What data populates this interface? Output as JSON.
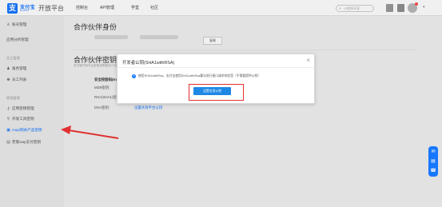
{
  "header": {
    "logo_glyph": "支",
    "brand_name": "支付宝",
    "brand_sub": "ALIPAY",
    "portal_title": "开放平台",
    "nav": [
      "控制台",
      "API管理",
      "学堂",
      "社区"
    ],
    "search_placeholder": "小程序开发",
    "icons": [
      "search-icon",
      "message-icon",
      "notification-icon",
      "avatar",
      "chevron-down-icon"
    ]
  },
  "sidebar": {
    "items": [
      {
        "label": "账号管理",
        "icon": "user-icon",
        "section": null
      },
      {
        "label": "应用分析管理",
        "icon": null,
        "section": null
      }
    ],
    "sections": [
      "员工管理",
      "密钥管理"
    ],
    "staff_items": [
      {
        "label": "角色管理",
        "icon": "role-icon"
      },
      {
        "label": "员工列表",
        "icon": "team-icon"
      }
    ],
    "key_items": [
      {
        "label": "应用密钥管理",
        "icon": "key-icon"
      },
      {
        "label": "开发工具密钥",
        "icon": "tool-icon"
      },
      {
        "label": "mapi网关产品密钥",
        "icon": "gateway-icon",
        "active": true
      },
      {
        "label": "老版wap支付密钥",
        "icon": "wap-icon"
      }
    ]
  },
  "main": {
    "partner_title": "合作伙伴身份",
    "copy_label": "复制",
    "key_title": "合作伙伴密钥",
    "key_subtitle": "支付宝开放平台密钥说明相关介绍",
    "key_table_header": "安全校验码(Key)",
    "key_rows": [
      "MD5密钥:",
      "RSA(SHA1)密钥:",
      "DSA密钥:"
    ],
    "dsa_link": "设置开放平台公钥"
  },
  "modal": {
    "title": "开发者公钥(SHA1withRSA)",
    "close_glyph": "×",
    "info_text": "使用SHA1withRsa，支付宝使用SHA1withRsa算法进行接口请求的验签（不需要提供公钥）",
    "primary_button": "设置应用公钥"
  },
  "floating_toolbar": {
    "icons": [
      "chat-icon",
      "document-icon",
      "feedback-icon"
    ],
    "glyphs": [
      "✉",
      "▤",
      "☎"
    ]
  },
  "colors": {
    "accent": "#1677ff",
    "annotation": "#e03131",
    "button": "#1e88e5"
  }
}
